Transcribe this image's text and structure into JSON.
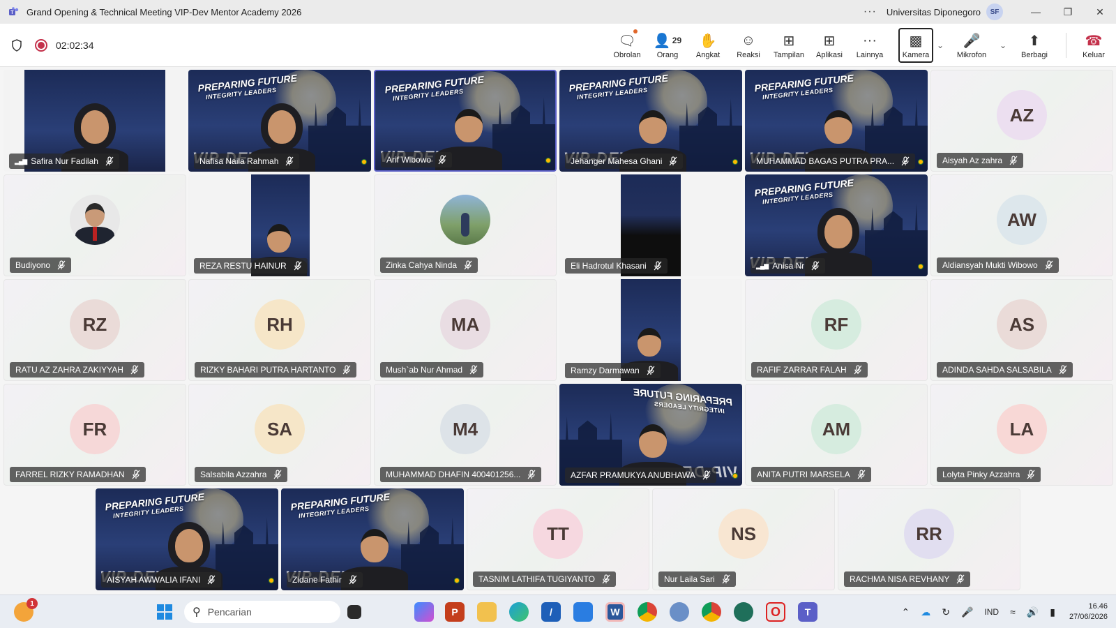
{
  "window": {
    "title": "Grand Opening & Technical Meeting VIP-Dev Mentor Academy 2026",
    "more": "···",
    "org": "Universitas Diponegoro",
    "user_initials": "SF"
  },
  "meeting": {
    "timer": "02:02:34",
    "tools": {
      "chat": "Obrolan",
      "people": "Orang",
      "people_count": "29",
      "raise": "Angkat",
      "react": "Reaksi",
      "view": "Tampilan",
      "apps": "Aplikasi",
      "more": "Lainnya",
      "camera": "Kamera",
      "mic": "Mikrofon",
      "share": "Berbagi",
      "leave": "Keluar"
    }
  },
  "background_text": {
    "line1": "PREPARING FUTURE",
    "line2": "INTEGRITY LEADERS",
    "brand": "VIP-DEV"
  },
  "participants": [
    {
      "name": "Safira Nur Fadilah",
      "kind": "video-strip"
    },
    {
      "name": "Nafisa Naila Rahmah",
      "kind": "video"
    },
    {
      "name": "Arif Wibowo",
      "kind": "video",
      "active": true
    },
    {
      "name": "Jehanger Mahesa Ghani",
      "kind": "video"
    },
    {
      "name": "MUHAMMAD BAGAS PUTRA PRA...",
      "kind": "video"
    },
    {
      "name": "Aisyah Az zahra",
      "kind": "initials",
      "initials": "AZ",
      "color": "#ecdff0"
    },
    {
      "name": "Budiyono",
      "kind": "photo"
    },
    {
      "name": "REZA RESTU HAINUR",
      "kind": "video-strip"
    },
    {
      "name": "Zinka Cahya Ninda",
      "kind": "photo"
    },
    {
      "name": "Eli Hadrotul Khasani",
      "kind": "video-strip"
    },
    {
      "name": "Anisa Nr",
      "kind": "video"
    },
    {
      "name": "Aldiansyah Mukti Wibowo",
      "kind": "initials",
      "initials": "AW",
      "color": "#dde7ec"
    },
    {
      "name": "RATU AZ ZAHRA ZAKIYYAH",
      "kind": "initials",
      "initials": "RZ",
      "color": "#eadbd8"
    },
    {
      "name": "RIZKY BAHARI PUTRA HARTANTO",
      "kind": "initials",
      "initials": "RH",
      "color": "#f6e6c8"
    },
    {
      "name": "Mush`ab Nur Ahmad",
      "kind": "initials",
      "initials": "MA",
      "color": "#e9dde3"
    },
    {
      "name": "Ramzy Darmawan",
      "kind": "video-strip"
    },
    {
      "name": "RAFIF ZARRAR FALAH",
      "kind": "initials",
      "initials": "RF",
      "color": "#d6ecdf"
    },
    {
      "name": "ADINDA SAHDA SALSABILA",
      "kind": "initials",
      "initials": "AS",
      "color": "#eadbd8"
    },
    {
      "name": "FARREL RIZKY RAMADHAN",
      "kind": "initials",
      "initials": "FR",
      "color": "#f6d8d8"
    },
    {
      "name": "Salsabila Azzahra",
      "kind": "initials",
      "initials": "SA",
      "color": "#f6e6c8"
    },
    {
      "name": "MUHAMMAD DHAFIN 400401256...",
      "kind": "initials",
      "initials": "M4",
      "color": "#dde3e8"
    },
    {
      "name": "AZFAR PRAMUKYA ANUBHAWA",
      "kind": "video"
    },
    {
      "name": "ANITA PUTRI MARSELA",
      "kind": "initials",
      "initials": "AM",
      "color": "#d6ecdf"
    },
    {
      "name": "Lolyta Pinky Azzahra",
      "kind": "initials",
      "initials": "LA",
      "color": "#f8d8d6"
    },
    {
      "name": "AISYAH AWWALIA IFANI",
      "kind": "video"
    },
    {
      "name": "Zidane Fathir",
      "kind": "video"
    },
    {
      "name": "TASNIM LATHIFA TUGIYANTO",
      "kind": "initials",
      "initials": "TT",
      "color": "#f6d8e0"
    },
    {
      "name": "Nur Laila Sari",
      "kind": "initials",
      "initials": "NS",
      "color": "#f8e6d2"
    },
    {
      "name": "RACHMA NISA REVHANY",
      "kind": "initials",
      "initials": "RR",
      "color": "#e1def0"
    }
  ],
  "taskbar": {
    "notification_count": "1",
    "search_placeholder": "Pencarian",
    "lang": "IND",
    "time": "16.46",
    "date": "27/06/2026"
  },
  "colors": {
    "accent": "#5b5fc7",
    "record": "#c4314b"
  }
}
